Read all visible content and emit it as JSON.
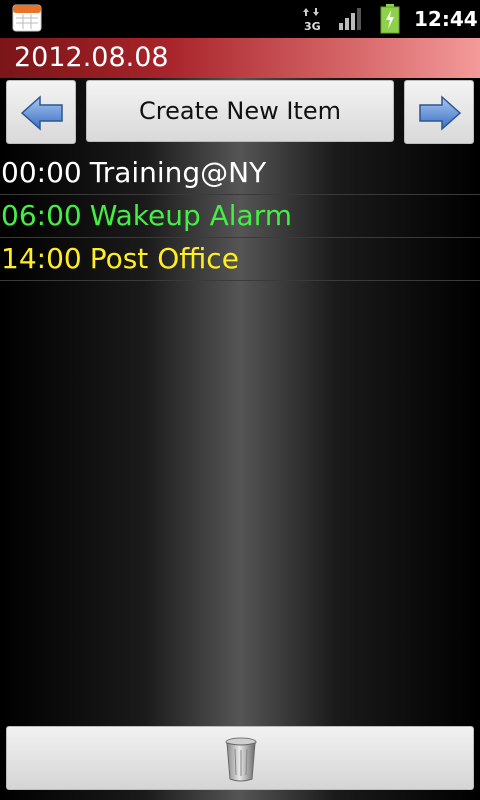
{
  "statusbar": {
    "network": "3G",
    "time": "12:44",
    "icons": [
      "calendar-app-icon",
      "3g-data-icon",
      "signal-icon",
      "battery-charging-icon"
    ]
  },
  "header": {
    "date": "2012.08.08",
    "accent": "#a8242a"
  },
  "toolbar": {
    "prev_icon": "left-arrow-icon",
    "create_label": "Create New Item",
    "next_icon": "right-arrow-icon"
  },
  "items": [
    {
      "time": "00:00",
      "title": "Training@NY",
      "color": "#ffffff"
    },
    {
      "time": "06:00",
      "title": "Wakeup Alarm",
      "color": "#44ee44"
    },
    {
      "time": "14:00",
      "title": "Post Office",
      "color": "#ffee22"
    }
  ],
  "footer": {
    "delete_icon": "trash-icon"
  }
}
